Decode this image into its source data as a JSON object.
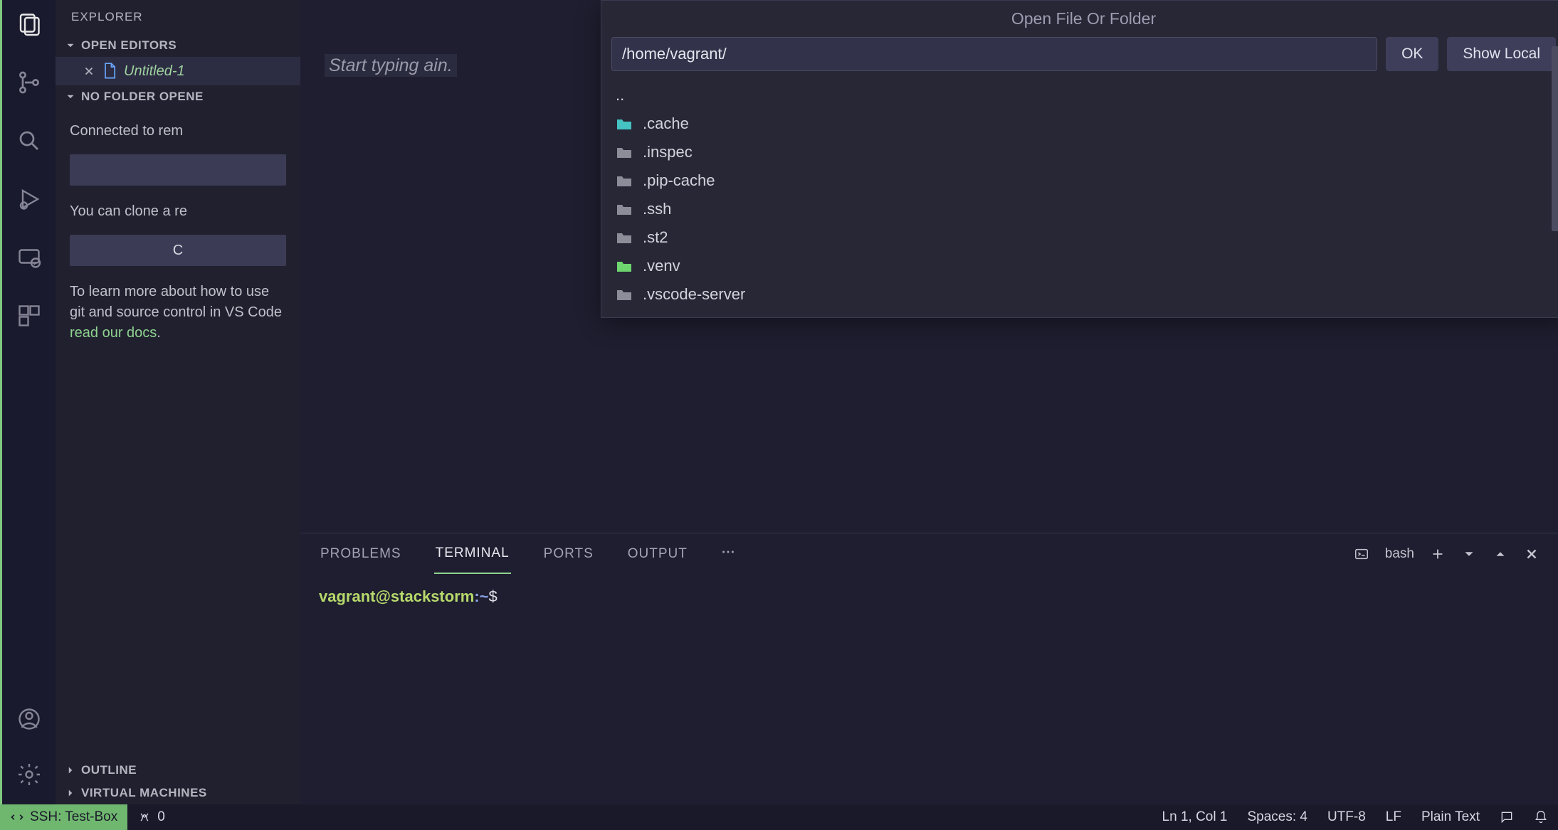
{
  "sidebar": {
    "title": "EXPLORER",
    "open_editors_label": "OPEN EDITORS",
    "open_file_name": "Untitled-1",
    "no_folder_label": "NO FOLDER OPENE",
    "connected_text": "Connected to rem",
    "clone_text": "You can clone a re",
    "clone_btn_char": "C",
    "learn_text_prefix": "To learn more about how to use git and source control in VS Code ",
    "learn_link": "read our docs",
    "outline_label": "OUTLINE",
    "vm_label": "VIRTUAL MACHINES"
  },
  "quick_open": {
    "title": "Open File Or Folder",
    "input_value": "/home/vagrant/",
    "ok_label": "OK",
    "show_local_label": "Show Local",
    "items": [
      {
        "name": "..",
        "type": "up"
      },
      {
        "name": ".cache",
        "type": "teal"
      },
      {
        "name": ".inspec",
        "type": "folder"
      },
      {
        "name": ".pip-cache",
        "type": "folder"
      },
      {
        "name": ".ssh",
        "type": "folder"
      },
      {
        "name": ".st2",
        "type": "folder"
      },
      {
        "name": ".venv",
        "type": "green"
      },
      {
        "name": ".vscode-server",
        "type": "folder"
      }
    ]
  },
  "editor": {
    "hint_text": "Start typing ain."
  },
  "panel": {
    "tabs": {
      "problems": "PROBLEMS",
      "terminal": "TERMINAL",
      "ports": "PORTS",
      "output": "OUTPUT"
    },
    "term_name": "bash",
    "prompt_user": "vagrant@stackstorm",
    "prompt_path": ":~",
    "prompt_symbol": "$"
  },
  "status": {
    "remote": "SSH: Test-Box",
    "ports": "0",
    "ln_col": "Ln 1, Col 1",
    "spaces": "Spaces: 4",
    "encoding": "UTF-8",
    "eol": "LF",
    "lang": "Plain Text"
  }
}
